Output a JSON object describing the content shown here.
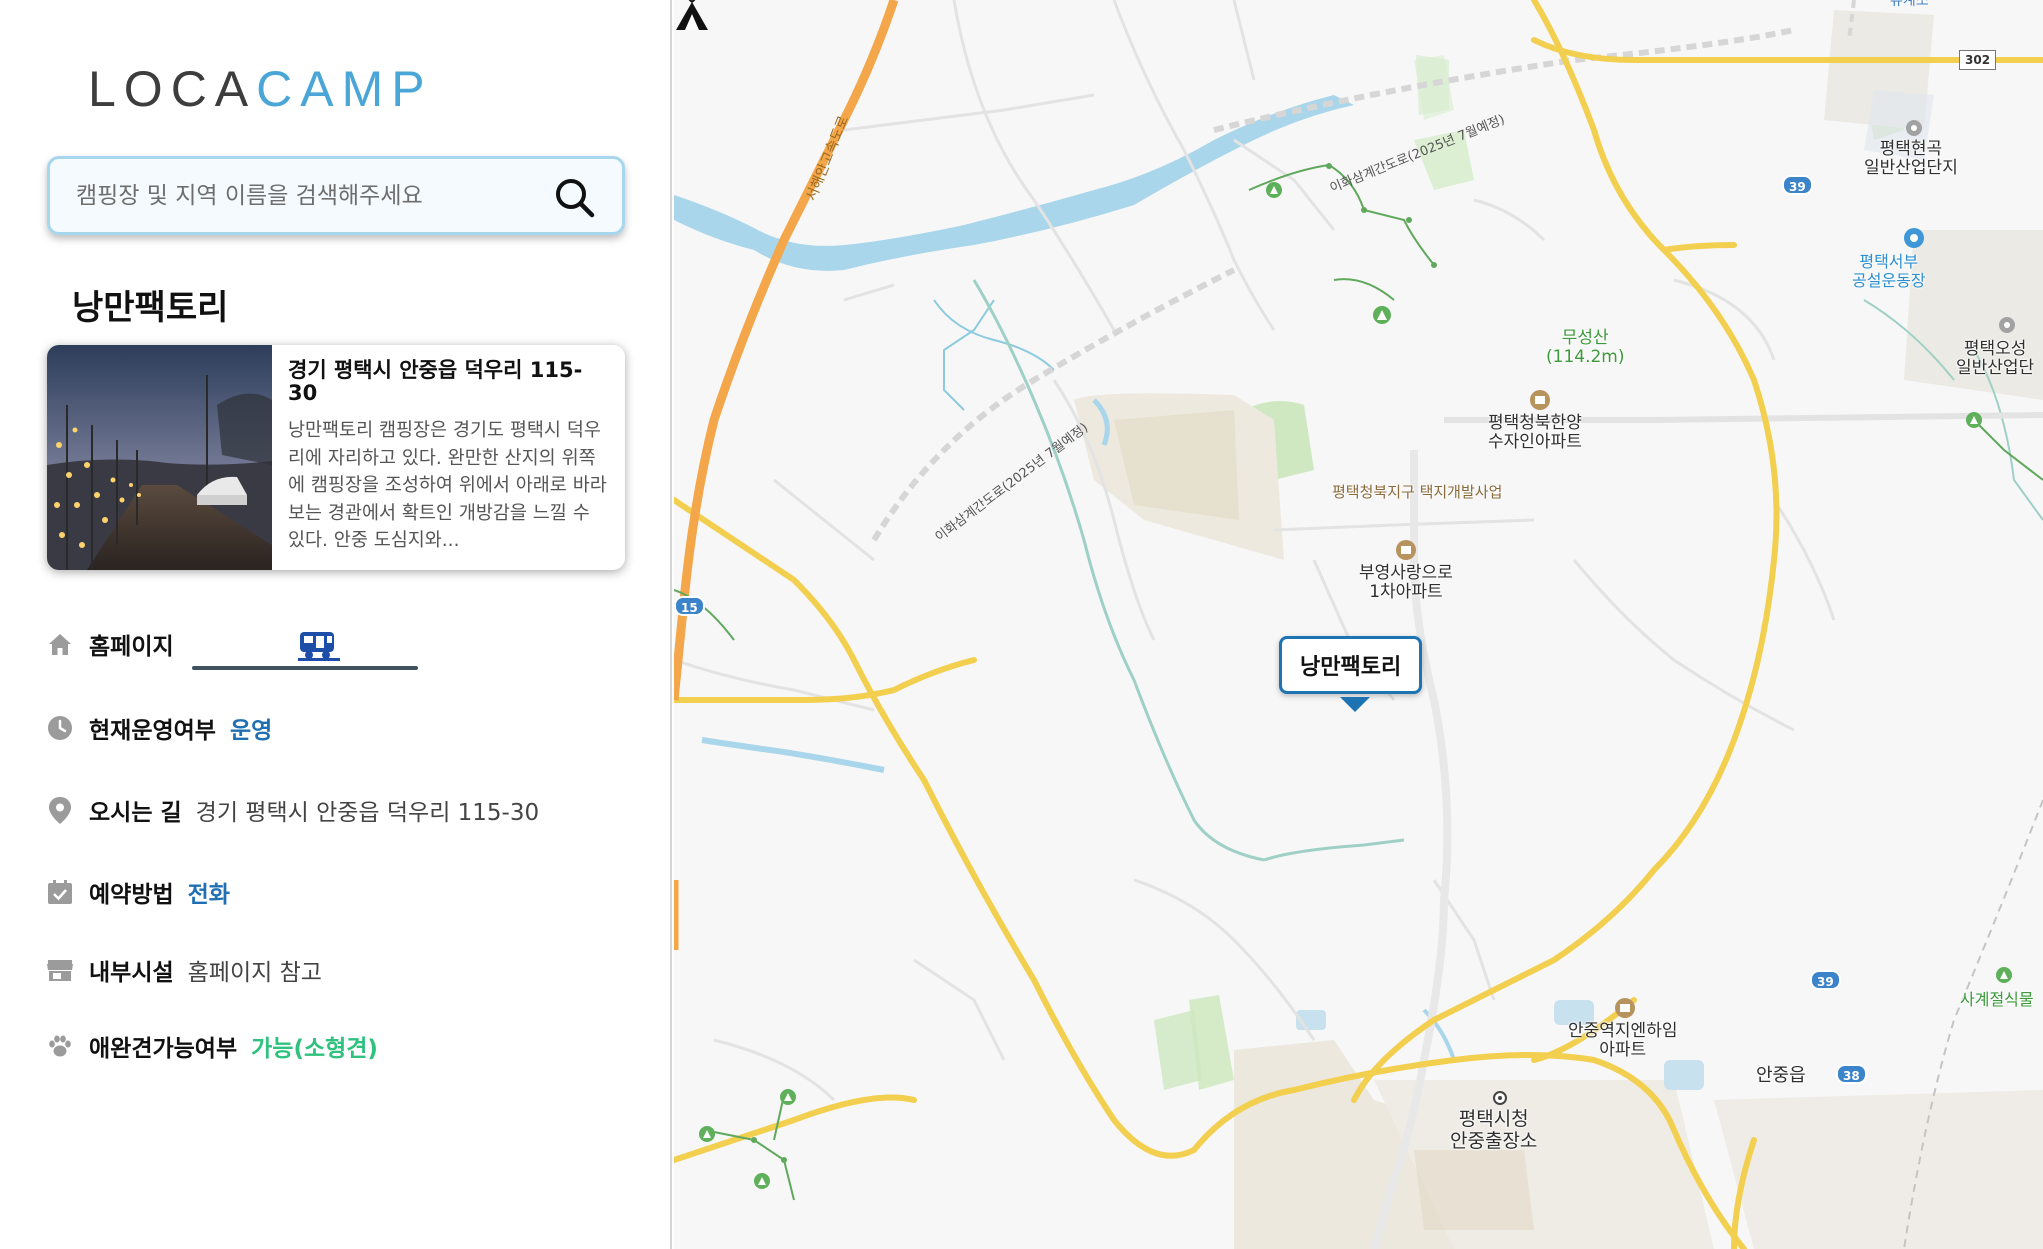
{
  "logo": {
    "part1": "LOCA",
    "part2": "CAMP"
  },
  "search": {
    "placeholder": "캠핑장 및 지역 이름을 검색해주세요",
    "value": ""
  },
  "place": {
    "title": "낭만팩토리",
    "card": {
      "address": "경기 평택시 안중읍 덕우리 115-30",
      "description": "낭만팩토리 캠핑장은 경기도 평택시 덕우리에 자리하고 있다. 완만한 산지의 위쪽에 캠핑장을 조성하여 위에서 아래로 바라보는 경관에서 확트인 개방감을 느낄 수 있다. 안중 도심지와..."
    },
    "info": {
      "homepage_label": "홈페이지",
      "status_label": "현재운영여부",
      "status_value": "운영",
      "directions_label": "오시는 길",
      "directions_value": "경기 평택시 안중읍 덕우리 115-30",
      "reservation_label": "예약방법",
      "reservation_value": "전화",
      "facilities_label": "내부시설",
      "facilities_value": "홈페이지 참고",
      "pet_label": "애완견가능여부",
      "pet_value": "가능(소형견)"
    }
  },
  "map": {
    "marker_label": "낭만팩토리",
    "labels": {
      "hyeongok": "평택현곡\n일반산업단지",
      "seobu": "평택서부\n공설운동장",
      "osung": "평택오성\n일반산업단",
      "museongsan": "무성산\n(114.2m)",
      "cheongbuk_apt": "평택청북한양\n수자인아파트",
      "cheongbuk_dev": "평택청북지구 택지개발사업",
      "buyoung": "부영사랑으로\n1차아파트",
      "anjung_station": "안중역지엔하임\n아파트",
      "anjung_eup": "안중읍",
      "city_hall": "평택시청\n안중출장소",
      "sagye": "사계절식물",
      "expressway": "서해안고속도로",
      "road_top": "이화삼계간도로(2025년 7월예정)",
      "road_mid": "이화삼계간도로(2025년 7월예정)",
      "top_edge": "유계소"
    },
    "route_shields": [
      "302",
      "39",
      "15",
      "39",
      "38"
    ]
  },
  "colors": {
    "accent": "#4aa6d6",
    "link_blue": "#1f6fb2",
    "pet_green": "#2ec27e",
    "marker_border": "#1e73b3",
    "road_yellow": "#f2cf4e",
    "expressway_orange": "#f3a64a",
    "river": "#a9d6ea"
  },
  "icons": {
    "search": "search-icon",
    "home": "home-icon",
    "clock": "clock-icon",
    "location": "location-pin-icon",
    "calendar": "calendar-check-icon",
    "store": "store-icon",
    "paw": "paw-icon",
    "rv": "camper-van-icon",
    "tent": "tent-icon"
  }
}
